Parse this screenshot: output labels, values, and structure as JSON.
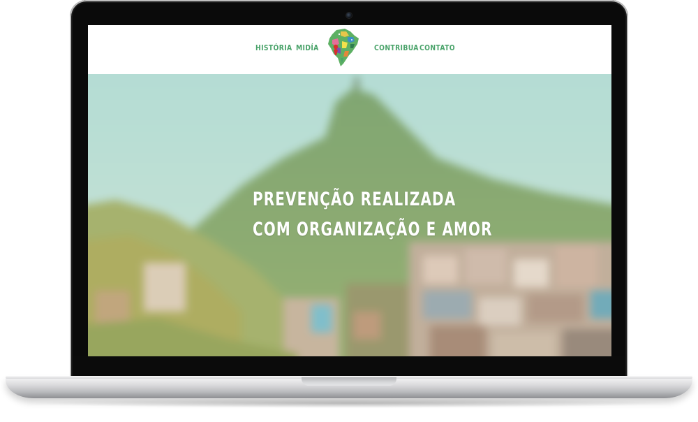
{
  "nav": {
    "items": [
      {
        "label": "HISTÓRIA"
      },
      {
        "label": "MIDÍA"
      },
      {
        "label": "CONTRIBUA"
      },
      {
        "label": "CONTATO"
      }
    ],
    "logo_icon": "brazil-map-logo-icon",
    "link_color": "#4aa36a"
  },
  "hero": {
    "title_line1": "PREVENÇÃO REALIZADA",
    "title_line2": "COM ORGANIZAÇÃO E AMOR",
    "background": "blurred-rio-hillside-photo",
    "text_color": "#ffffff"
  }
}
